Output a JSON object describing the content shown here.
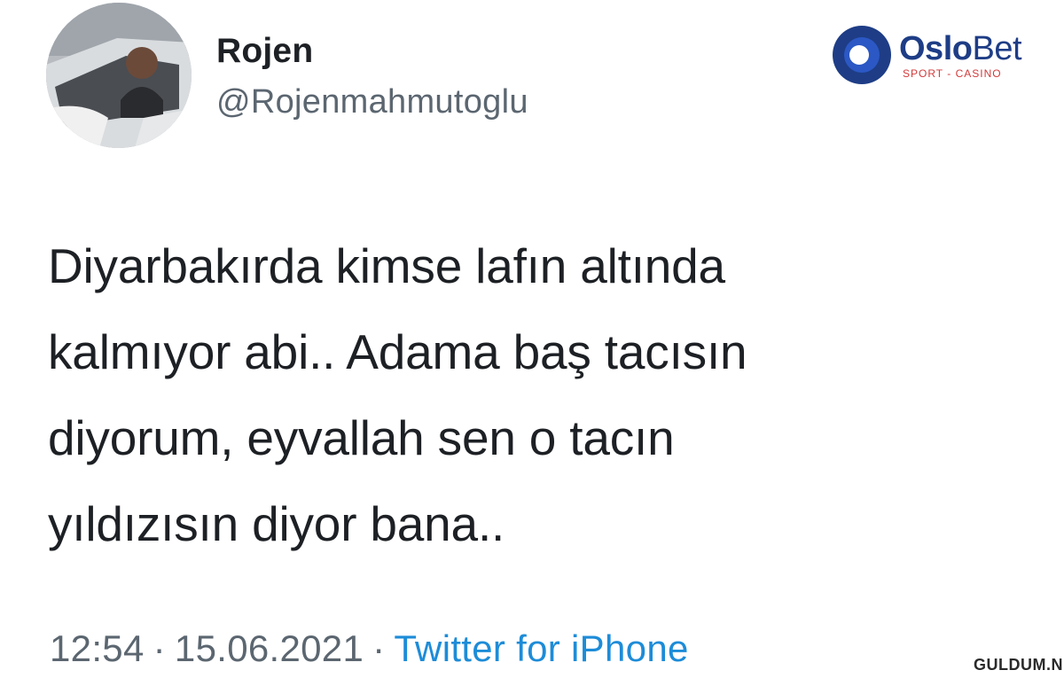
{
  "profile": {
    "name": "Rojen",
    "handle": "@Rojenmahmutoglu",
    "avatar_icon": "profile-photo"
  },
  "brand": {
    "name_bold": "Oslo",
    "name_light": "Bet",
    "tagline": "SPORT - CASINO",
    "colors": {
      "primary": "#1e3d86",
      "accent": "#d23a3a"
    }
  },
  "tweet": {
    "lines": [
      "Diyarbakırda kimse lafın altında",
      "kalmıyor abi.. Adama baş tacısın",
      "diyorum, eyvallah sen o tacın",
      "yıldızısın diyor bana.."
    ]
  },
  "meta": {
    "time": "12:54",
    "separator": "·",
    "date": "15.06.2021",
    "source": "Twitter for iPhone"
  },
  "watermark": "GULDUM.NET",
  "colors": {
    "text": "#1d2024",
    "muted": "#5b6670",
    "link": "#1d8cd8"
  }
}
